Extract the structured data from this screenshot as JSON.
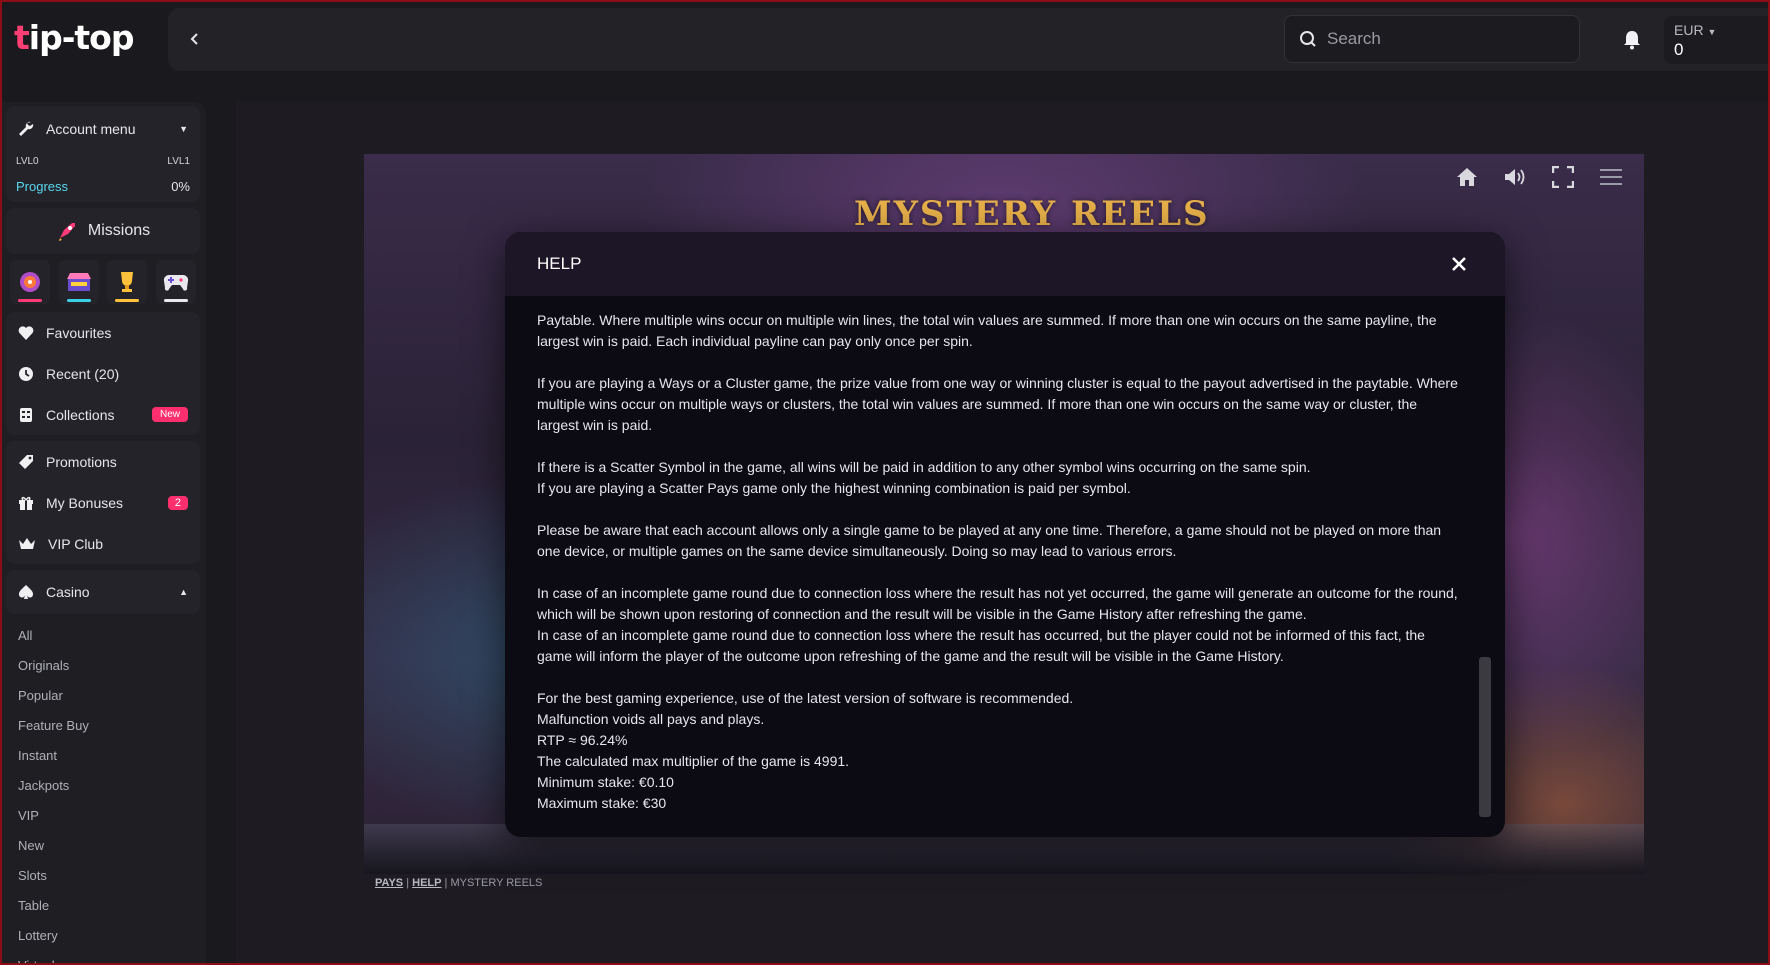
{
  "brand": {
    "logo_text": "tip-top"
  },
  "header": {
    "search_placeholder": "Search",
    "wallet": {
      "currency": "EUR",
      "balance": "0"
    }
  },
  "sidebar": {
    "account_menu": "Account menu",
    "level_from": "LVL0",
    "level_to": "LVL1",
    "progress_label": "Progress",
    "progress_value": "0%",
    "missions": "Missions",
    "tiles": [
      "missions-wheel",
      "store",
      "tournaments-trophy",
      "games-gamepad"
    ],
    "tile_colors": [
      "#ff3a77",
      "#3ad0e6",
      "#ffc23a",
      "#e8e8ee"
    ],
    "items": [
      {
        "label": "Favourites"
      },
      {
        "label": "Recent (20)"
      },
      {
        "label": "Collections",
        "badge": "New"
      },
      {
        "label": "Promotions"
      },
      {
        "label": "My Bonuses",
        "badge": "2"
      },
      {
        "label": "VIP Club"
      },
      {
        "label": "Casino"
      }
    ],
    "casino_sub": [
      "All",
      "Originals",
      "Popular",
      "Feature Buy",
      "Instant",
      "Jackpots",
      "VIP",
      "New",
      "Slots",
      "Table",
      "Lottery",
      "Virtuals"
    ]
  },
  "game": {
    "title": "MYSTERY REELS",
    "footer": {
      "pays": "PAYS",
      "help": "HELP",
      "game_name": "MYSTERY REELS",
      "separator": "|"
    }
  },
  "modal": {
    "title": "HELP",
    "paragraphs": [
      "Paytable. Where multiple wins occur on multiple win lines, the total win values are summed. If more than one win occurs on the same payline, the largest win is paid. Each individual payline can pay only once per spin.",
      "If you are playing a Ways or a Cluster game, the prize value from one way or winning cluster is equal to the payout advertised in the paytable. Where multiple wins occur on multiple ways or clusters, the total win values are summed. If more than one win occurs on the same way or cluster, the largest win is paid.",
      "If there is a Scatter Symbol in the game, all wins will be paid in addition to any other symbol wins occurring on the same spin.",
      "If you are playing a Scatter Pays game only the highest winning combination is paid per symbol.",
      "Please be aware that each account allows only a single game to be played at any one time. Therefore, a game should not be played on more than one device, or multiple games on the same device simultaneously. Doing so may lead to various errors.",
      "In case of an incomplete game round due to connection loss where the result has not yet occurred, the game will generate an outcome for the round, which will be shown upon restoring of connection and the result will be visible in the Game History after refreshing the game.",
      "In case of an incomplete game round due to connection loss where the result has occurred, but the player could not be informed of this fact, the game will inform the player of the outcome upon refreshing of the game and the result will be visible in the Game History.",
      "For the best gaming experience, use of the latest version of software is recommended.",
      "Malfunction voids all pays and plays.",
      "RTP ≈ 96.24%",
      "The calculated max multiplier of the game is 4991.",
      "Minimum stake: €0.10",
      "Maximum stake: €30"
    ]
  },
  "colors": {
    "accent": "#ff2f6e",
    "progress": "#5ad8f0",
    "gold": "#e7b049"
  }
}
